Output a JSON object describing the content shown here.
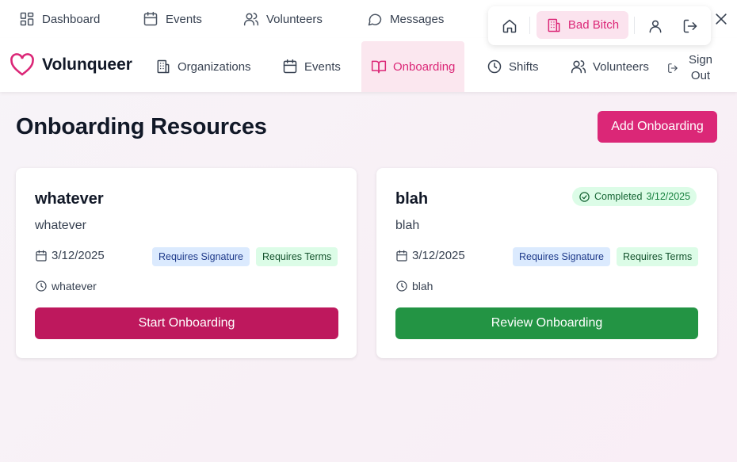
{
  "topnav": {
    "items": [
      {
        "label": "Dashboard",
        "icon": "dashboard-icon"
      },
      {
        "label": "Events",
        "icon": "calendar-icon"
      },
      {
        "label": "Volunteers",
        "icon": "users-icon"
      },
      {
        "label": "Messages",
        "icon": "message-icon"
      }
    ]
  },
  "quickbar": {
    "org_label": "Bad Bitch",
    "icons": [
      "home-icon",
      "building-icon",
      "user-icon",
      "logout-icon"
    ]
  },
  "brand": {
    "name": "Volunqueer",
    "icon": "heart-icon",
    "color": "#db2777"
  },
  "mainnav": {
    "items": [
      {
        "label": "Organizations",
        "icon": "building-icon"
      },
      {
        "label": "Events",
        "icon": "calendar-icon"
      },
      {
        "label": "Onboarding",
        "icon": "book-icon",
        "active": true
      },
      {
        "label": "Shifts",
        "icon": "clock-icon"
      },
      {
        "label": "Volunteers",
        "icon": "users-icon"
      }
    ],
    "signout_label": "Sign Out"
  },
  "page": {
    "title": "Onboarding Resources",
    "add_button": "Add Onboarding"
  },
  "cards": [
    {
      "title": "whatever",
      "description": "whatever",
      "date": "3/12/2025",
      "time_text": "whatever",
      "tags": [
        "Requires Signature",
        "Requires Terms"
      ],
      "button": "Start Onboarding",
      "status": null
    },
    {
      "title": "blah",
      "description": "blah",
      "date": "3/12/2025",
      "time_text": "blah",
      "tags": [
        "Requires Signature",
        "Requires Terms"
      ],
      "button": "Review Onboarding",
      "status": {
        "label": "Completed",
        "date": "3/12/2025"
      }
    }
  ],
  "colors": {
    "accent": "#db2777",
    "start_button": "#be185d",
    "review_button": "#239444",
    "tag_signature_bg": "#dbeafe",
    "tag_terms_bg": "#dcfce7"
  }
}
